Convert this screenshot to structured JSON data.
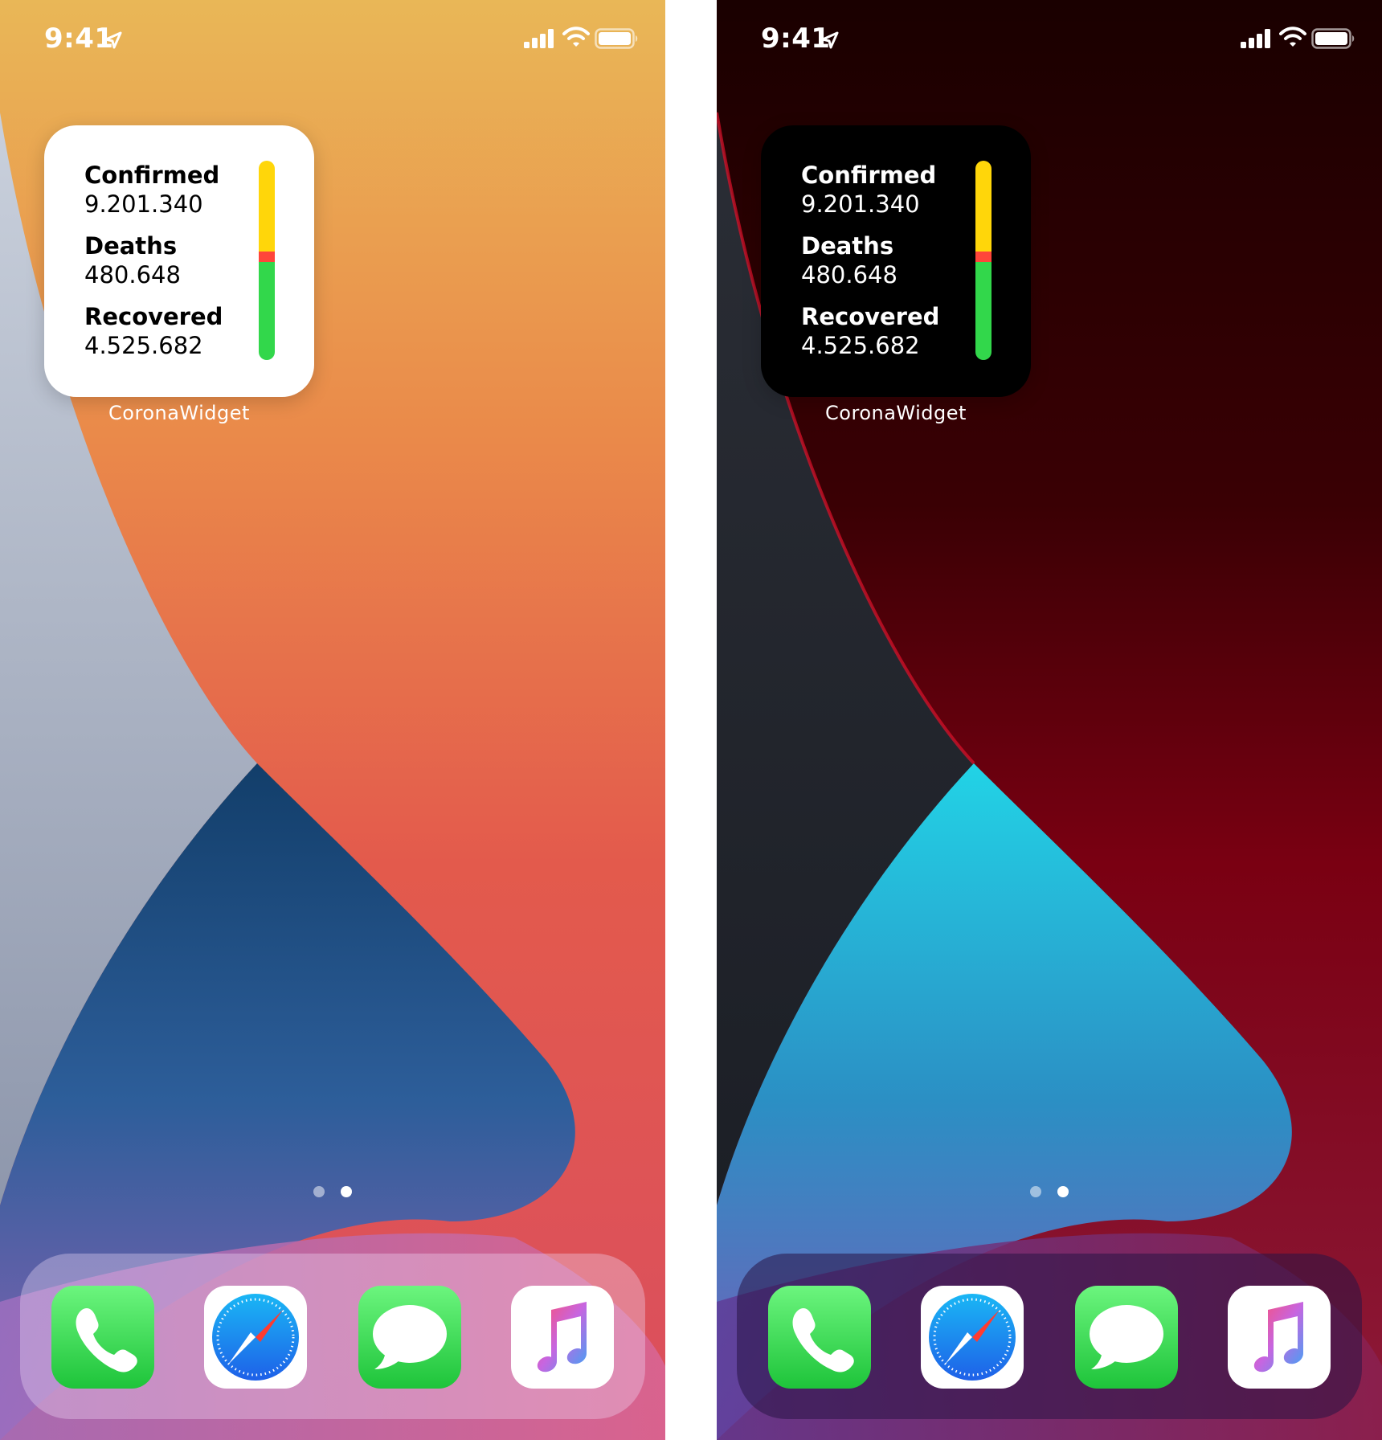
{
  "status_bar": {
    "time": "9:41"
  },
  "widget": {
    "stats": [
      {
        "label": "Confirmed",
        "value": "9.201.340"
      },
      {
        "label": "Deaths",
        "value": "480.648"
      },
      {
        "label": "Recovered",
        "value": "4.525.682"
      }
    ],
    "caption": "CoronaWidget",
    "bar_colors": {
      "active": "#FFD60A",
      "deaths": "#FF453A",
      "recovered": "#32D74B"
    }
  },
  "page_dots": {
    "count": 2,
    "active_index": 1
  },
  "dock": {
    "apps": [
      {
        "name": "Phone",
        "icon": "phone-icon"
      },
      {
        "name": "Safari",
        "icon": "safari-compass-icon"
      },
      {
        "name": "Messages",
        "icon": "messages-bubble-icon"
      },
      {
        "name": "Music",
        "icon": "music-note-icon"
      }
    ]
  },
  "screens": [
    {
      "appearance": "light",
      "widget_background": "#FFFFFF",
      "widget_text": "#000000"
    },
    {
      "appearance": "dark",
      "widget_background": "#000000",
      "widget_text": "#FFFFFF"
    }
  ]
}
